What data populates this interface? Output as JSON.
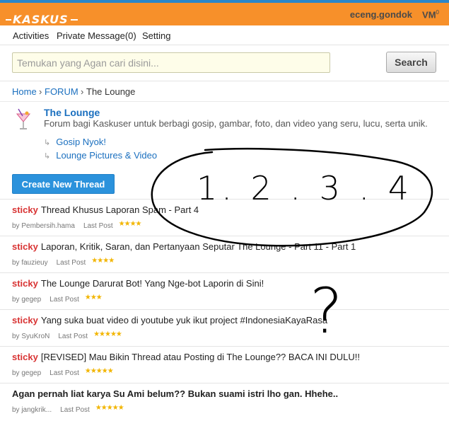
{
  "header": {
    "logo_text": "KASKUS",
    "username": "eceng.gondok",
    "vm_label": "VM",
    "vm_count": "0"
  },
  "nav": {
    "items": [
      {
        "label": "Activities"
      },
      {
        "label": "Private Message(0)"
      },
      {
        "label": "Setting"
      }
    ]
  },
  "search": {
    "placeholder": "Temukan yang Agan cari disini...",
    "button_label": "Search"
  },
  "breadcrumb": {
    "home": "Home",
    "forum": "FORUM",
    "sep": "›",
    "current": "The Lounge"
  },
  "forum": {
    "title": "The Lounge",
    "description": "Forum bagi Kaskuser untuk berbagi gosip, gambar, foto, dan video yang seru, lucu, serta unik.",
    "subforums": [
      {
        "label": "Gosip Nyok!"
      },
      {
        "label": "Lounge Pictures & Video"
      }
    ],
    "sub_arrow": "↳"
  },
  "create_thread_label": "Create New Thread",
  "threads": [
    {
      "sticky": "sticky",
      "title": "Thread Khusus Laporan Spam - Part 4",
      "by": "by Pembersih.hama",
      "last_post": "Last Post",
      "stars": "★★★★",
      "rating": 4
    },
    {
      "sticky": "sticky",
      "title": "Laporan, Kritik, Saran, dan Pertanyaan Seputar The Lounge - Part 11 - Part 1",
      "by": "by fauzieuy",
      "last_post": "Last Post",
      "stars": "★★★★",
      "rating": 4
    },
    {
      "sticky": "sticky",
      "title": "The Lounge Darurat Bot! Yang Nge-bot Laporin di Sini!",
      "by": "by gegep",
      "last_post": "Last Post",
      "stars": "★★★",
      "rating": 3
    },
    {
      "sticky": "sticky",
      "title": "Yang suka buat video di youtube yuk ikut project #IndonesiaKayaRasa",
      "by": "by SyuKroN",
      "last_post": "Last Post",
      "stars": "★★★★★",
      "rating": 5
    },
    {
      "sticky": "sticky",
      "title": "[REVISED] Mau Bikin Thread atau Posting di The Lounge?? BACA INI DULU!!",
      "by": "by gegep",
      "last_post": "Last Post",
      "stars": "★★★★★",
      "rating": 5
    },
    {
      "sticky": "",
      "title": "Agan pernah liat karya Su Ami belum?? Bukan suami istri lho gan. Hhehe..",
      "by": "by jangkrik...",
      "last_post": "Last Post",
      "stars": "★★★★★",
      "rating": 5
    }
  ],
  "annotation": {
    "text": "1. 2 . 3 . 4",
    "question": "?"
  },
  "colors": {
    "header_bg": "#f7902a",
    "header_border": "#2a86c9",
    "link": "#1a6fbf",
    "sticky": "#d83232",
    "button": "#2b92dc",
    "stars": "#f2b500"
  }
}
